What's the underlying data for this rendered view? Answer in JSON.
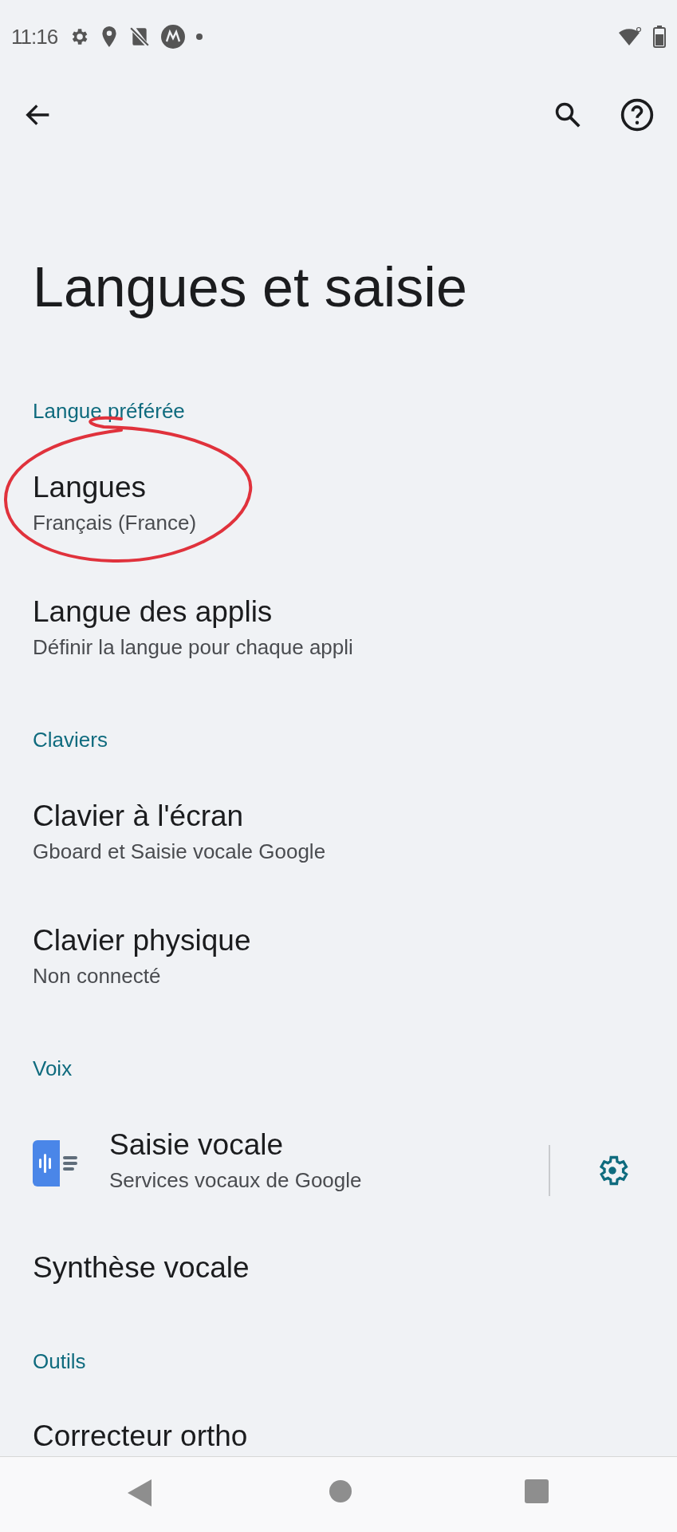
{
  "status_bar": {
    "time": "11:16"
  },
  "title": "Langues et saisie",
  "sections": [
    {
      "header": "Langue préférée",
      "items": [
        {
          "kind": "text",
          "title": "Langues",
          "subtitle": "Français (France)"
        },
        {
          "kind": "text",
          "title": "Langue des applis",
          "subtitle": "Définir la langue pour chaque appli"
        }
      ]
    },
    {
      "header": "Claviers",
      "items": [
        {
          "kind": "text",
          "title": "Clavier à l'écran",
          "subtitle": "Gboard et Saisie vocale Google"
        },
        {
          "kind": "text",
          "title": "Clavier physique",
          "subtitle": "Non connecté"
        }
      ]
    },
    {
      "header": "Voix",
      "items": [
        {
          "kind": "app_settings",
          "title": "Saisie vocale",
          "subtitle": "Services vocaux de Google"
        },
        {
          "kind": "text",
          "title": "Synthèse vocale"
        }
      ]
    },
    {
      "header": "Outils",
      "items": [
        {
          "kind": "text",
          "title": "Correcteur ortho"
        }
      ]
    }
  ]
}
